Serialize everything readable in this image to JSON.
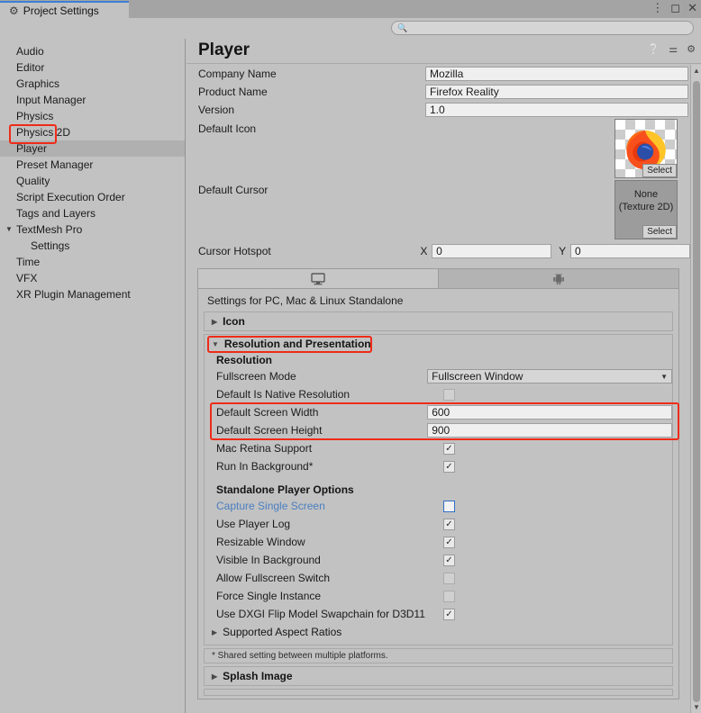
{
  "window": {
    "tab_label": "Project Settings",
    "tab_icon": "gear-icon",
    "menu_icon": "kebab-menu-icon",
    "maximize_icon": "maximize-icon",
    "close_icon": "close-icon"
  },
  "search": {
    "value": "",
    "placeholder": "",
    "icon": "search-icon"
  },
  "sidebar": {
    "items": [
      {
        "label": "Audio",
        "indent": false,
        "selected": false,
        "expandable": false
      },
      {
        "label": "Editor",
        "indent": false,
        "selected": false,
        "expandable": false
      },
      {
        "label": "Graphics",
        "indent": false,
        "selected": false,
        "expandable": false
      },
      {
        "label": "Input Manager",
        "indent": false,
        "selected": false,
        "expandable": false
      },
      {
        "label": "Physics",
        "indent": false,
        "selected": false,
        "expandable": false
      },
      {
        "label": "Physics 2D",
        "indent": false,
        "selected": false,
        "expandable": false
      },
      {
        "label": "Player",
        "indent": false,
        "selected": true,
        "expandable": false
      },
      {
        "label": "Preset Manager",
        "indent": false,
        "selected": false,
        "expandable": false
      },
      {
        "label": "Quality",
        "indent": false,
        "selected": false,
        "expandable": false
      },
      {
        "label": "Script Execution Order",
        "indent": false,
        "selected": false,
        "expandable": false
      },
      {
        "label": "Tags and Layers",
        "indent": false,
        "selected": false,
        "expandable": false
      },
      {
        "label": "TextMesh Pro",
        "indent": false,
        "selected": false,
        "expandable": true
      },
      {
        "label": "Settings",
        "indent": true,
        "selected": false,
        "expandable": false
      },
      {
        "label": "Time",
        "indent": false,
        "selected": false,
        "expandable": false
      },
      {
        "label": "VFX",
        "indent": false,
        "selected": false,
        "expandable": false
      },
      {
        "label": "XR Plugin Management",
        "indent": false,
        "selected": false,
        "expandable": false
      }
    ]
  },
  "panel": {
    "title": "Player",
    "header_icons": [
      "help-icon",
      "preset-icon",
      "gear-icon"
    ]
  },
  "general": {
    "company_name": {
      "label": "Company Name",
      "value": "Mozilla"
    },
    "product_name": {
      "label": "Product Name",
      "value": "Firefox Reality"
    },
    "version": {
      "label": "Version",
      "value": "1.0"
    },
    "default_icon": {
      "label": "Default Icon",
      "select_label": "Select",
      "image": "firefox-logo"
    },
    "default_cursor": {
      "label": "Default Cursor",
      "value_line1": "None",
      "value_line2": "(Texture 2D)",
      "select_label": "Select"
    },
    "cursor_hotspot": {
      "label": "Cursor Hotspot",
      "x_label": "X",
      "x": "0",
      "y_label": "Y",
      "y": "0"
    }
  },
  "platform_tabs": [
    {
      "icon": "desktop-monitor-icon",
      "active": true
    },
    {
      "icon": "android-robot-icon",
      "active": false
    }
  ],
  "settings_for": "Settings for PC, Mac & Linux Standalone",
  "sections": {
    "icon": {
      "label": "Icon",
      "expanded": false
    },
    "resolution_and_presentation": {
      "label": "Resolution and Presentation",
      "expanded": true,
      "highlighted": true
    },
    "splash_image": {
      "label": "Splash Image",
      "expanded": false
    }
  },
  "resolution": {
    "heading": "Resolution",
    "fullscreen_mode": {
      "label": "Fullscreen Mode",
      "value": "Fullscreen Window"
    },
    "default_is_native_resolution": {
      "label": "Default Is Native Resolution",
      "checked": false
    },
    "default_screen_width": {
      "label": "Default Screen Width",
      "value": "600",
      "highlighted": true
    },
    "default_screen_height": {
      "label": "Default Screen Height",
      "value": "900",
      "highlighted": true
    },
    "mac_retina_support": {
      "label": "Mac Retina Support",
      "checked": true
    },
    "run_in_background": {
      "label": "Run In Background*",
      "checked": true
    }
  },
  "standalone_player_options": {
    "heading": "Standalone Player Options",
    "rows": [
      {
        "label": "Capture Single Screen",
        "checked": false,
        "link": true
      },
      {
        "label": "Use Player Log",
        "checked": true,
        "link": false
      },
      {
        "label": "Resizable Window",
        "checked": true,
        "link": false
      },
      {
        "label": "Visible In Background",
        "checked": true,
        "link": false
      },
      {
        "label": "Allow Fullscreen Switch",
        "checked": false,
        "link": false
      },
      {
        "label": "Force Single Instance",
        "checked": false,
        "link": false
      },
      {
        "label": "Use DXGI Flip Model Swapchain for D3D11",
        "checked": true,
        "link": false
      }
    ],
    "supported_aspect_ratios": "Supported Aspect Ratios"
  },
  "footnote": "* Shared setting between multiple platforms.",
  "colors": {
    "accent_red": "#ee2b18",
    "link_blue": "#4a7fc1",
    "tab_accent": "#3b7fd4"
  }
}
